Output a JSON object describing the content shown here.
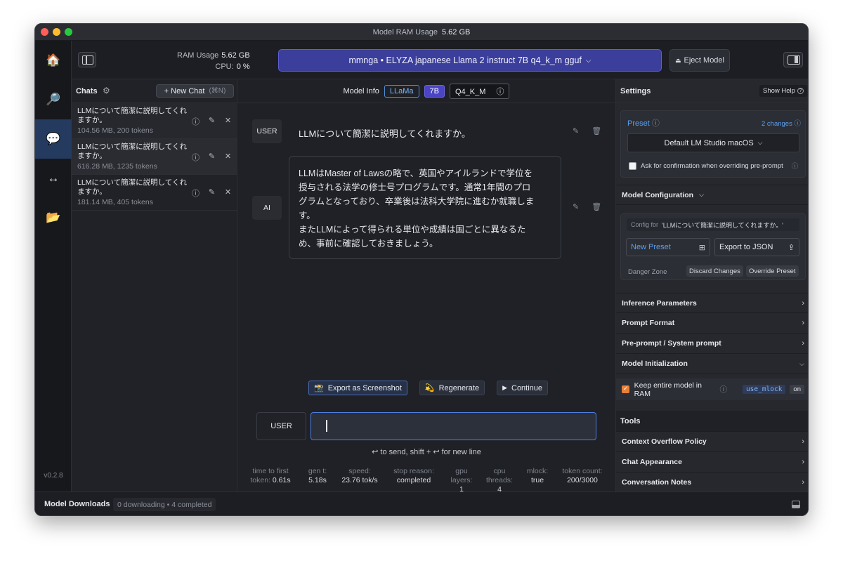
{
  "window": {
    "title_label": "Model RAM Usage",
    "title_value": "5.62 GB"
  },
  "rail": {
    "items": [
      {
        "name": "home",
        "icon": "🏠"
      },
      {
        "name": "search",
        "icon": "🔎"
      },
      {
        "name": "chat",
        "icon": "💬"
      },
      {
        "name": "server",
        "icon": "↔"
      },
      {
        "name": "folder",
        "icon": "📂"
      }
    ],
    "version": "v0.2.8"
  },
  "header": {
    "ram_label": "RAM Usage",
    "ram_value": "5.62 GB",
    "cpu_label": "CPU:",
    "cpu_value": "0 %",
    "model_name": "mmnga • ELYZA japanese Llama 2 instruct 7B q4_k_m gguf",
    "model_chevron": "⌵",
    "eject_icon": "⏏",
    "eject_label": "Eject Model"
  },
  "chats": {
    "title": "Chats",
    "gear_icon": "⚙",
    "new_chat_label": "+ New Chat",
    "new_chat_shortcut": "(⌘N)",
    "items": [
      {
        "title": "LLMについて簡潔に説明してくれますか。",
        "meta": "104.56 MB, 200 tokens"
      },
      {
        "title": "LLMについて簡潔に説明してくれますか。",
        "meta": "616.28 MB, 1235 tokens"
      },
      {
        "title": "LLMについて簡潔に説明してくれますか。",
        "meta": "181.14 MB, 405 tokens"
      }
    ],
    "item_icons": {
      "info": "ⓘ",
      "edit": "✎",
      "close": "✕"
    }
  },
  "main": {
    "model_info_label": "Model Info",
    "tags": {
      "arch": "LLaMa",
      "size": "7B",
      "quant": "Q4_K_M",
      "quant_icon": "ⓘ"
    },
    "messages": [
      {
        "role": "USER",
        "text": "LLMについて簡潔に説明してくれますか。"
      },
      {
        "role": "AI",
        "lines": [
          "LLMはMaster of Lawsの略で、英国やアイルランドで学位を",
          "授与される法学の修士号プログラムです。通常1年間のプロ",
          "グラムとなっており、卒業後は法科大学院に進むか就職しま",
          "す。",
          "またLLMによって得られる単位や成績は国ごとに異なるた",
          "め、事前に確認しておきましょう。"
        ]
      }
    ],
    "msg_icons": {
      "edit": "✎",
      "delete": "🗑"
    },
    "actions": {
      "screenshot_icon": "📸",
      "screenshot": "Export as Screenshot",
      "regenerate_icon": "💫",
      "regenerate": "Regenerate",
      "continue_icon": "▶",
      "continue": "Continue"
    },
    "input_role": "USER",
    "input_value": "",
    "send_hint": "↩ to send, shift + ↩ for new line",
    "stats": [
      {
        "label1": "time to first",
        "label2": "token:",
        "value": "0.61s"
      },
      {
        "label1": "gen t:",
        "value": "5.18s"
      },
      {
        "label1": "speed:",
        "value": "23.76 tok/s"
      },
      {
        "label1": "stop reason:",
        "value": "completed"
      },
      {
        "label1": "gpu",
        "label2": "layers:",
        "value": "1"
      },
      {
        "label1": "cpu",
        "label2": "threads:",
        "value": "4"
      },
      {
        "label1": "mlock:",
        "value": "true"
      },
      {
        "label1": "token count:",
        "value": "200/3000"
      }
    ]
  },
  "settings": {
    "title": "Settings",
    "show_help": "Show Help",
    "help_icon": "?",
    "preset_label": "Preset",
    "info_icon": "ⓘ",
    "changes": "2 changes",
    "preset_value": "Default LM Studio macOS",
    "confirm_label": "Ask for confirmation when overriding pre-prompt",
    "model_config": "Model Configuration",
    "config_for_label": "Config for",
    "config_for_value": "'LLMについて簡潔に説明してくれますか。'",
    "new_preset": "New Preset",
    "new_preset_icon": "⊞",
    "export_json": "Export to JSON",
    "export_icon": "⇪",
    "danger_zone": "Danger Zone",
    "discard": "Discard Changes",
    "override": "Override Preset",
    "sections": [
      "Inference Parameters",
      "Prompt Format",
      "Pre-prompt / System prompt"
    ],
    "model_init": "Model Initialization",
    "keep_label": "Keep entire model in RAM",
    "keep_checked": true,
    "mlock_tag": "use_mlock",
    "mlock_state": "on",
    "tools_title": "Tools",
    "tools": [
      "Context Overflow Policy",
      "Chat Appearance",
      "Conversation Notes"
    ],
    "chevron_right": "›",
    "chevron_down": "⌵"
  },
  "bottom": {
    "downloads_label": "Model Downloads",
    "downloads_status": "0 downloading • 4 completed"
  },
  "colors": {
    "accent": "#3b3e9a",
    "link": "#5aa0ee",
    "selected_nav": "#243a5e",
    "checkbox": "#e8803a"
  }
}
